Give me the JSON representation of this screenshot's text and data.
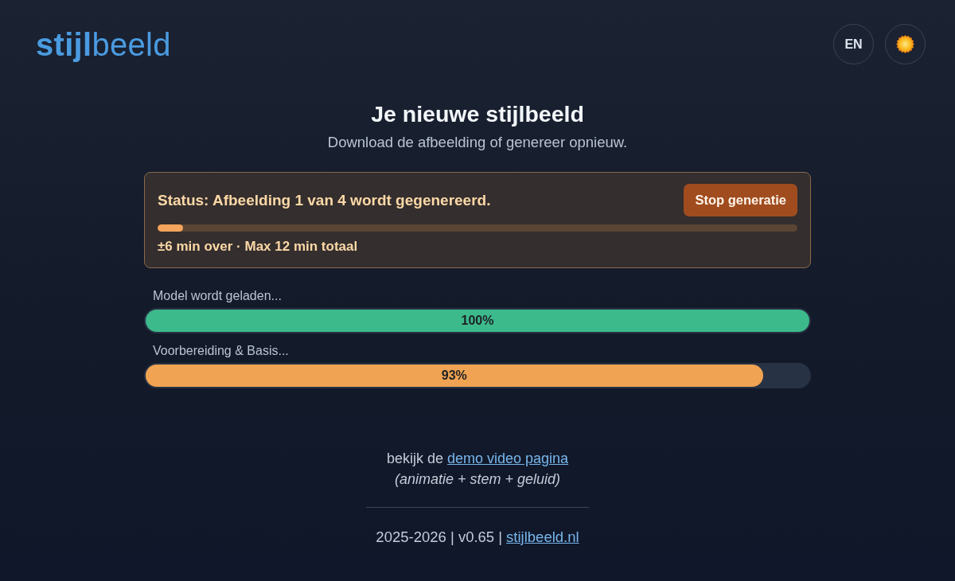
{
  "header": {
    "logo": "**stijl**beeld",
    "language_button": "EN"
  },
  "heading": {
    "title": "Je nieuwe stijlbeeld",
    "subtitle": "Download de afbeelding of genereer opnieuw."
  },
  "status_card": {
    "status": "Status: Afbeelding 1 van 4 wordt gegenereerd.",
    "stop_button": "Stop generatie",
    "level": 0.04,
    "time_info": "±6 min over · Max 12 min totaal"
  },
  "stages": [
    {
      "label": "Model wordt geladen...",
      "level": 1.0,
      "reading": "100%",
      "color": "#3dba8c"
    },
    {
      "label": "Voorbereiding & Basis...",
      "level": 0.93,
      "reading": "93%",
      "color": "#f0a352"
    }
  ],
  "footer": {
    "demo_prompt": "bekijk de",
    "demo_link": "demo video pagina",
    "demo_note": "(animatie + stem + geluid)",
    "credits": "2025-2026 | v0.65 |",
    "site_link": "stijlbeeld.nl"
  }
}
